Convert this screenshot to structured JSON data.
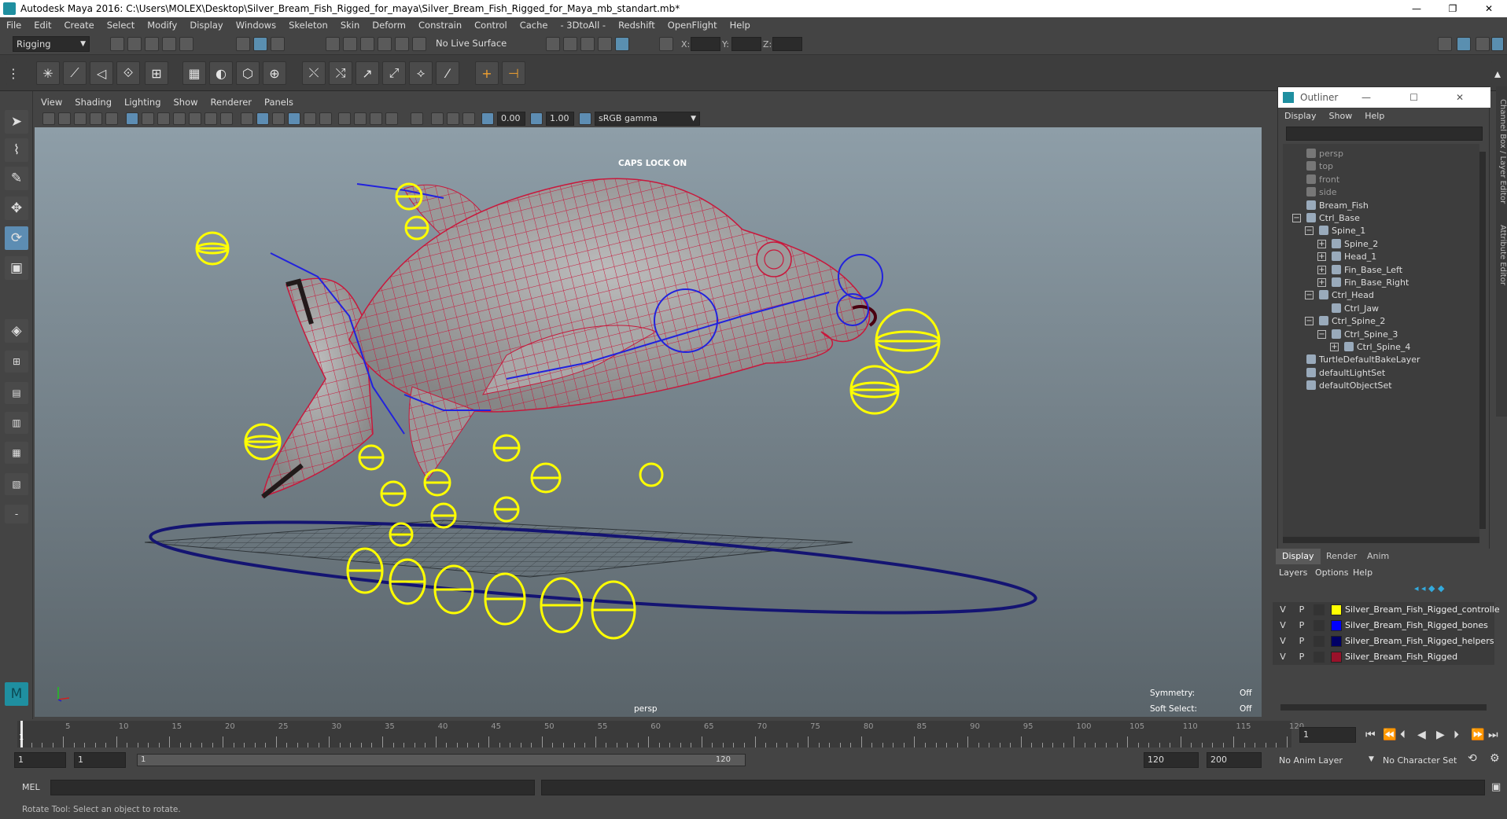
{
  "window": {
    "title": "Autodesk Maya 2016: C:\\Users\\MOLEX\\Desktop\\Silver_Bream_Fish_Rigged_for_maya\\Silver_Bream_Fish_Rigged_for_Maya_mb_standart.mb*",
    "minimize": "—",
    "restore": "❐",
    "close": "✕"
  },
  "menubar": [
    "File",
    "Edit",
    "Create",
    "Select",
    "Modify",
    "Display",
    "Windows",
    "Skeleton",
    "Skin",
    "Deform",
    "Constrain",
    "Control",
    "Cache",
    "- 3DtoAll -",
    "Redshift",
    "OpenFlight",
    "Help"
  ],
  "status": {
    "menuset": "Rigging",
    "live_surface": "No Live Surface",
    "x_label": "X:",
    "y_label": "Y:",
    "z_label": "Z:"
  },
  "panel": {
    "menus": [
      "View",
      "Shading",
      "Lighting",
      "Show",
      "Renderer",
      "Panels"
    ],
    "field_a": "0.00",
    "field_b": "1.00",
    "colorspace": "sRGB gamma"
  },
  "viewport": {
    "caps": "CAPS LOCK ON",
    "camera": "persp",
    "symmetry_label": "Symmetry:",
    "symmetry_value": "Off",
    "softselect_label": "Soft Select:",
    "softselect_value": "Off"
  },
  "outliner": {
    "title": "Outliner",
    "menus": [
      "Display",
      "Show",
      "Help"
    ],
    "rows": [
      {
        "label": "persp",
        "indent": 0,
        "dim": true
      },
      {
        "label": "top",
        "indent": 0,
        "dim": true
      },
      {
        "label": "front",
        "indent": 0,
        "dim": true
      },
      {
        "label": "side",
        "indent": 0,
        "dim": true
      },
      {
        "label": "Bream_Fish",
        "indent": 0
      },
      {
        "label": "Ctrl_Base",
        "indent": 0,
        "exp": "−"
      },
      {
        "label": "Spine_1",
        "indent": 1,
        "exp": "−"
      },
      {
        "label": "Spine_2",
        "indent": 2,
        "exp": "+"
      },
      {
        "label": "Head_1",
        "indent": 2,
        "exp": "+"
      },
      {
        "label": "Fin_Base_Left",
        "indent": 2,
        "exp": "+"
      },
      {
        "label": "Fin_Base_Right",
        "indent": 2,
        "exp": "+"
      },
      {
        "label": "Ctrl_Head",
        "indent": 1,
        "exp": "−"
      },
      {
        "label": "Ctrl_Jaw",
        "indent": 2
      },
      {
        "label": "Ctrl_Spine_2",
        "indent": 1,
        "exp": "−"
      },
      {
        "label": "Ctrl_Spine_3",
        "indent": 2,
        "exp": "−"
      },
      {
        "label": "Ctrl_Spine_4",
        "indent": 3,
        "exp": "+"
      },
      {
        "label": "TurtleDefaultBakeLayer",
        "indent": 0
      },
      {
        "label": "defaultLightSet",
        "indent": 0
      },
      {
        "label": "defaultObjectSet",
        "indent": 0
      }
    ]
  },
  "layers": {
    "tabs": [
      "Display",
      "Render",
      "Anim"
    ],
    "menus": [
      "Layers",
      "Options",
      "Help"
    ],
    "rows": [
      {
        "v": "V",
        "p": "P",
        "color": "#ffff00",
        "name": "Silver_Bream_Fish_Rigged_controlle"
      },
      {
        "v": "V",
        "p": "P",
        "color": "#0000ff",
        "name": "Silver_Bream_Fish_Rigged_bones"
      },
      {
        "v": "V",
        "p": "P",
        "color": "#000066",
        "name": "Silver_Bream_Fish_Rigged_helpers"
      },
      {
        "v": "V",
        "p": "P",
        "color": "#99112a",
        "name": "Silver_Bream_Fish_Rigged"
      }
    ]
  },
  "sidetabs": [
    "Channel Box / Layer Editor",
    "Attribute Editor"
  ],
  "timeline": {
    "labels": [
      "5",
      "10",
      "15",
      "20",
      "25",
      "30",
      "35",
      "40",
      "45",
      "50",
      "55",
      "60",
      "65",
      "70",
      "75",
      "80",
      "85",
      "90",
      "95",
      "100",
      "105",
      "110",
      "115",
      "120"
    ],
    "current_marker": "1",
    "current_frame": "1"
  },
  "range": {
    "start": "1",
    "playback_start": "1",
    "slider_left": "1",
    "slider_right": "120",
    "playback_end": "120",
    "end": "200",
    "anim_layer": "No Anim Layer",
    "char_set": "No Character Set"
  },
  "command": {
    "label": "MEL"
  },
  "helpline": "Rotate Tool: Select an object to rotate.",
  "colors": {
    "mesh_wire": "#c8183c",
    "controls": "#ffff00",
    "bones": "#2222dd",
    "base_ring": "#141472"
  }
}
